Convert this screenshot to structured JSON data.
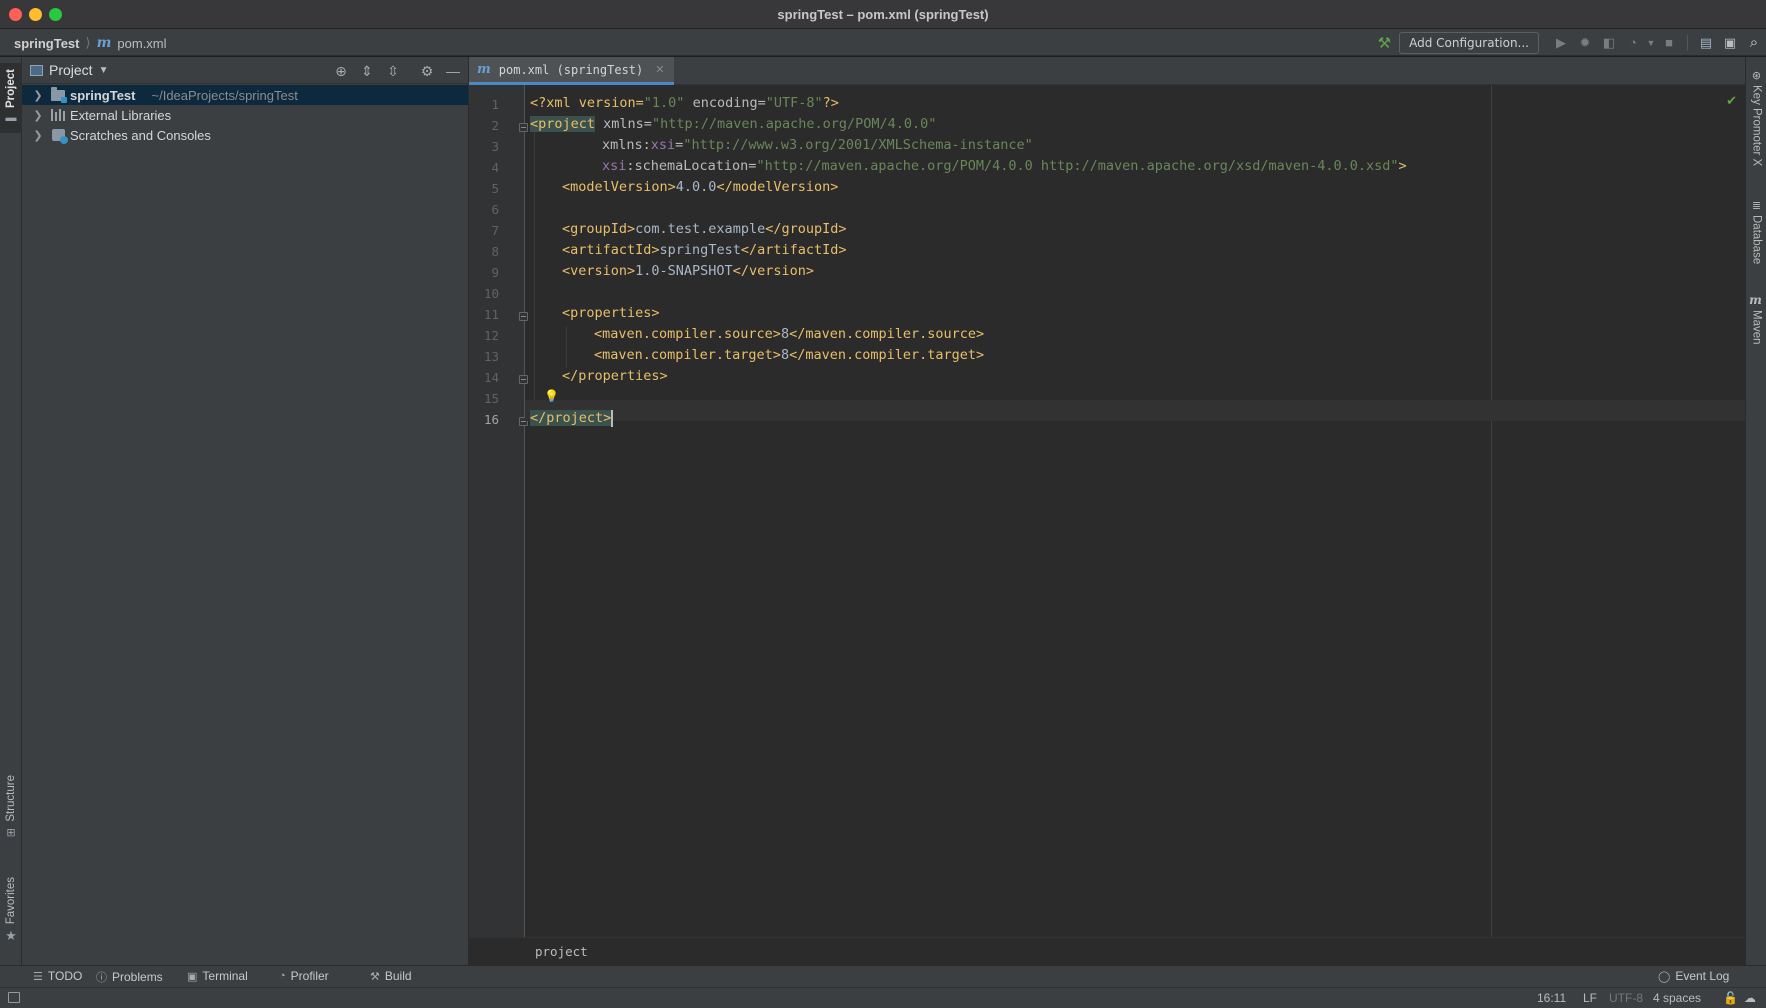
{
  "window": {
    "title": "springTest – pom.xml (springTest)"
  },
  "navbar": {
    "breadcrumb": [
      "springTest",
      "pom.xml"
    ],
    "add_config_label": "Add Configuration..."
  },
  "left_strip": {
    "project": "Project",
    "structure": "Structure",
    "favorites": "Favorites"
  },
  "project_panel": {
    "title": "Project",
    "tree": [
      {
        "label": "springTest",
        "path": "~/IdeaProjects/springTest"
      },
      {
        "label": "External Libraries"
      },
      {
        "label": "Scratches and Consoles"
      }
    ]
  },
  "editor": {
    "tab_label": "pom.xml (springTest)",
    "line_numbers": [
      "1",
      "2",
      "3",
      "4",
      "5",
      "6",
      "7",
      "8",
      "9",
      "10",
      "11",
      "12",
      "13",
      "14",
      "15",
      "16"
    ],
    "current_line": "16",
    "code": {
      "l1_a": "<?xml version=",
      "l1_b": "\"1.0\"",
      "l1_c": " encoding=",
      "l1_d": "\"UTF-8\"",
      "l1_e": "?>",
      "l2_a": "<project",
      "l2_b": " xmlns=",
      "l2_c": "\"http://maven.apache.org/POM/4.0.0\"",
      "l3_a": "xmlns:",
      "l3_b": "xsi",
      "l3_c": "=",
      "l3_d": "\"http://www.w3.org/2001/XMLSchema-instance\"",
      "l4_a": "xsi",
      "l4_b": ":schemaLocation=",
      "l4_c": "\"http://maven.apache.org/POM/4.0.0 http://maven.apache.org/xsd/maven-4.0.0.xsd\"",
      "l4_d": ">",
      "l5_a": "<modelVersion>",
      "l5_b": "4.0.0",
      "l5_c": "</modelVersion>",
      "l7_a": "<groupId>",
      "l7_b": "com.test.example",
      "l7_c": "</groupId>",
      "l8_a": "<artifactId>",
      "l8_b": "springTest",
      "l8_c": "</artifactId>",
      "l9_a": "<version>",
      "l9_b": "1.0-SNAPSHOT",
      "l9_c": "</version>",
      "l11_a": "<properties>",
      "l12_a": "<maven.compiler.source>",
      "l12_b": "8",
      "l12_c": "</maven.compiler.source>",
      "l13_a": "<maven.compiler.target>",
      "l13_b": "8",
      "l13_c": "</maven.compiler.target>",
      "l14_a": "</properties>",
      "l16_a": "</project>"
    },
    "footer_breadcrumb": "project"
  },
  "right_strip": {
    "key_promoter": "Key Promoter X",
    "database": "Database",
    "maven": "Maven"
  },
  "bottom_tools": {
    "todo": "TODO",
    "problems": "Problems",
    "terminal": "Terminal",
    "profiler": "Profiler",
    "build": "Build",
    "event_log": "Event Log"
  },
  "status": {
    "position": "16:11",
    "line_sep": "LF",
    "encoding": "UTF-8",
    "indent": "4 spaces"
  },
  "colors": {
    "accent": "#4a88c7",
    "selection": "#0d293e",
    "tag": "#e8bf6a",
    "string": "#6a8759",
    "namespace": "#9876aa"
  }
}
